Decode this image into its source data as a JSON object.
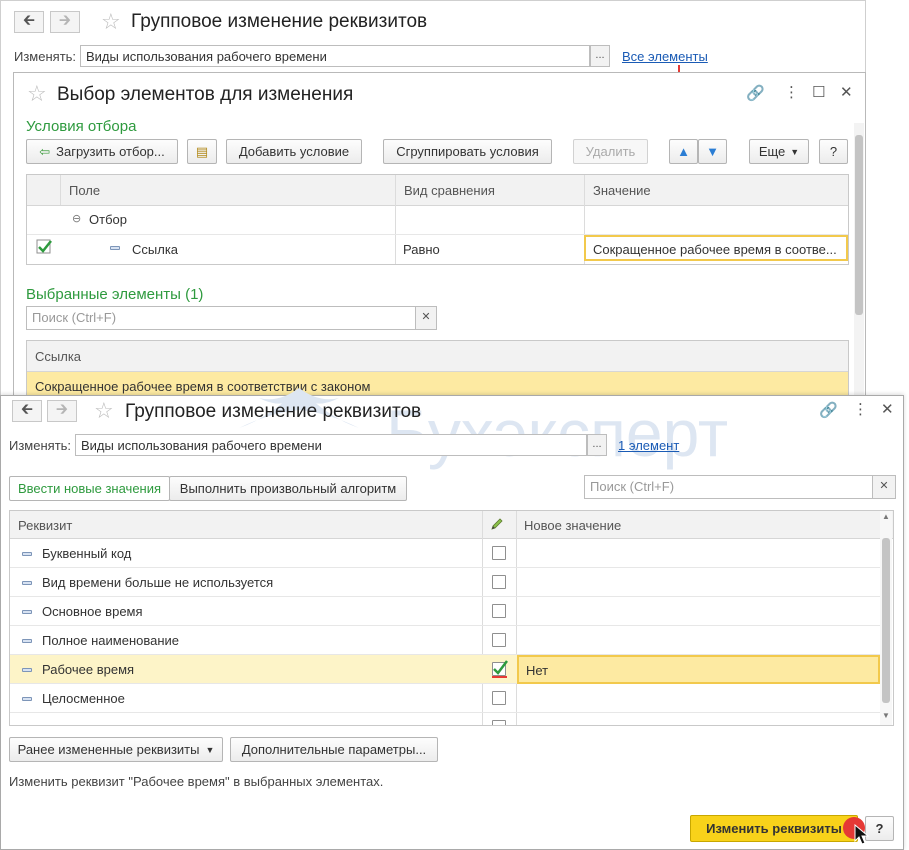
{
  "outer": {
    "title": "Групповое изменение реквизитов",
    "change_label": "Изменять:",
    "change_value": "Виды использования рабочего времени",
    "link": "Все элементы"
  },
  "selection": {
    "title": "Выбор элементов для изменения",
    "conditions_title": "Условия отбора",
    "toolbar": {
      "load_filter": "Загрузить отбор...",
      "add_condition": "Добавить условие",
      "group_conditions": "Сгруппировать условия",
      "delete": "Удалить",
      "more": "Еще",
      "help": "?"
    },
    "filter_grid": {
      "columns": [
        "Поле",
        "Вид сравнения",
        "Значение"
      ],
      "group_row": "Отбор",
      "row": {
        "field": "Ссылка",
        "comparison": "Равно",
        "value": "Сокращенное рабочее время в соотве..."
      }
    },
    "selected_title": "Выбранные элементы (1)",
    "search_placeholder": "Поиск (Ctrl+F)",
    "selected_grid": {
      "column": "Ссылка",
      "rows": [
        "Сокращенное рабочее время в соответствии с законом"
      ]
    }
  },
  "main": {
    "title": "Групповое изменение реквизитов",
    "change_label": "Изменять:",
    "change_value": "Виды использования рабочего времени",
    "link": "1 элемент",
    "tabs": [
      "Ввести новые значения",
      "Выполнить произвольный алгоритм"
    ],
    "search_placeholder": "Поиск (Ctrl+F)",
    "grid": {
      "columns": [
        "Реквизит",
        "Новое значение"
      ],
      "rows": [
        {
          "name": "Буквенный код",
          "checked": false,
          "value": ""
        },
        {
          "name": "Вид времени больше не используется",
          "checked": false,
          "value": ""
        },
        {
          "name": "Основное время",
          "checked": false,
          "value": ""
        },
        {
          "name": "Полное наименование",
          "checked": false,
          "value": ""
        },
        {
          "name": "Рабочее время",
          "checked": true,
          "value": "Нет"
        },
        {
          "name": "Целосменное",
          "checked": false,
          "value": ""
        }
      ]
    },
    "buttons": {
      "previous": "Ранее измененные реквизиты",
      "additional": "Дополнительные параметры...",
      "apply": "Изменить реквизиты",
      "help": "?"
    },
    "status": "Изменить реквизит \"Рабочее время\" в выбранных элементах.",
    "watermark": "Бухэксперт"
  },
  "colors": {
    "section_green": "#2e9a3e",
    "highlight_yellow": "#fdeaa2",
    "apply_button": "#f8d21a",
    "link_blue": "#1a5bb5"
  }
}
